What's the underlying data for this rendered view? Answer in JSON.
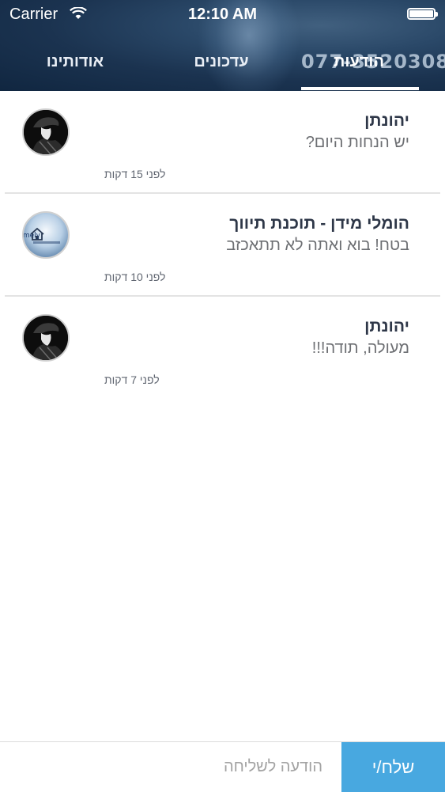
{
  "status_bar": {
    "carrier": "Carrier",
    "time": "12:10 AM"
  },
  "header": {
    "watermark": "077-3520308"
  },
  "tabs": [
    {
      "label": "אודותינו",
      "active": false
    },
    {
      "label": "עדכונים",
      "active": false
    },
    {
      "label": "הודעות",
      "active": true
    }
  ],
  "messages": [
    {
      "sender": "יהונתן",
      "text": "יש הנחות היום?",
      "time_ago": "לפני 15 דקות",
      "avatar": "person-avatar"
    },
    {
      "sender": "הומלי מידן - תוכנת תיווך",
      "text": "בטח! בוא ואתה לא תתאכזב",
      "time_ago": "לפני 10 דקות",
      "avatar": "homely-logo",
      "logo_text": "homely"
    },
    {
      "sender": "יהונתן",
      "text": "מעולה, תודה!!!",
      "time_ago": "לפני 7 דקות",
      "avatar": "person-avatar"
    }
  ],
  "composer": {
    "placeholder": "הודעה לשליחה",
    "send_label": "שלח/י"
  },
  "colors": {
    "header_dark": "#102640",
    "send_button": "#48a8e0",
    "sender_text": "#2e3748",
    "message_text": "#6d6f73"
  }
}
